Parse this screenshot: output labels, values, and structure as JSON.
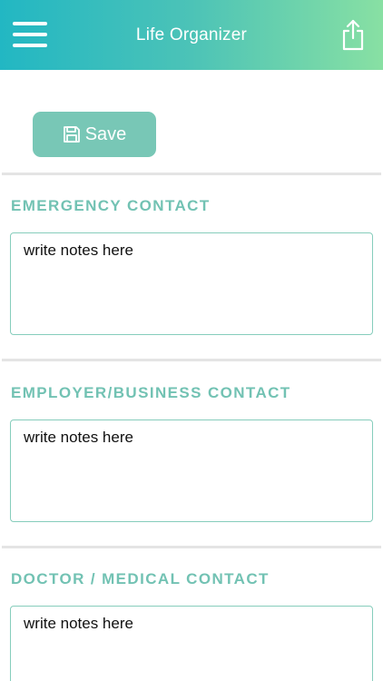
{
  "header": {
    "title": "Life Organizer",
    "menu_icon": "hamburger-menu-icon",
    "share_icon": "share-icon",
    "gradient_start": "#22b7c3",
    "gradient_end": "#88e0a3"
  },
  "toolbar": {
    "save_label": "Save",
    "save_icon": "floppy-disk-icon",
    "accent": "#78c7b6"
  },
  "sections": [
    {
      "title": "EMERGENCY CONTACT",
      "notes_text": "write notes here"
    },
    {
      "title": "EMPLOYER/BUSINESS CONTACT",
      "notes_text": "write notes here"
    },
    {
      "title": "DOCTOR / MEDICAL CONTACT",
      "notes_text": "write notes here"
    }
  ]
}
